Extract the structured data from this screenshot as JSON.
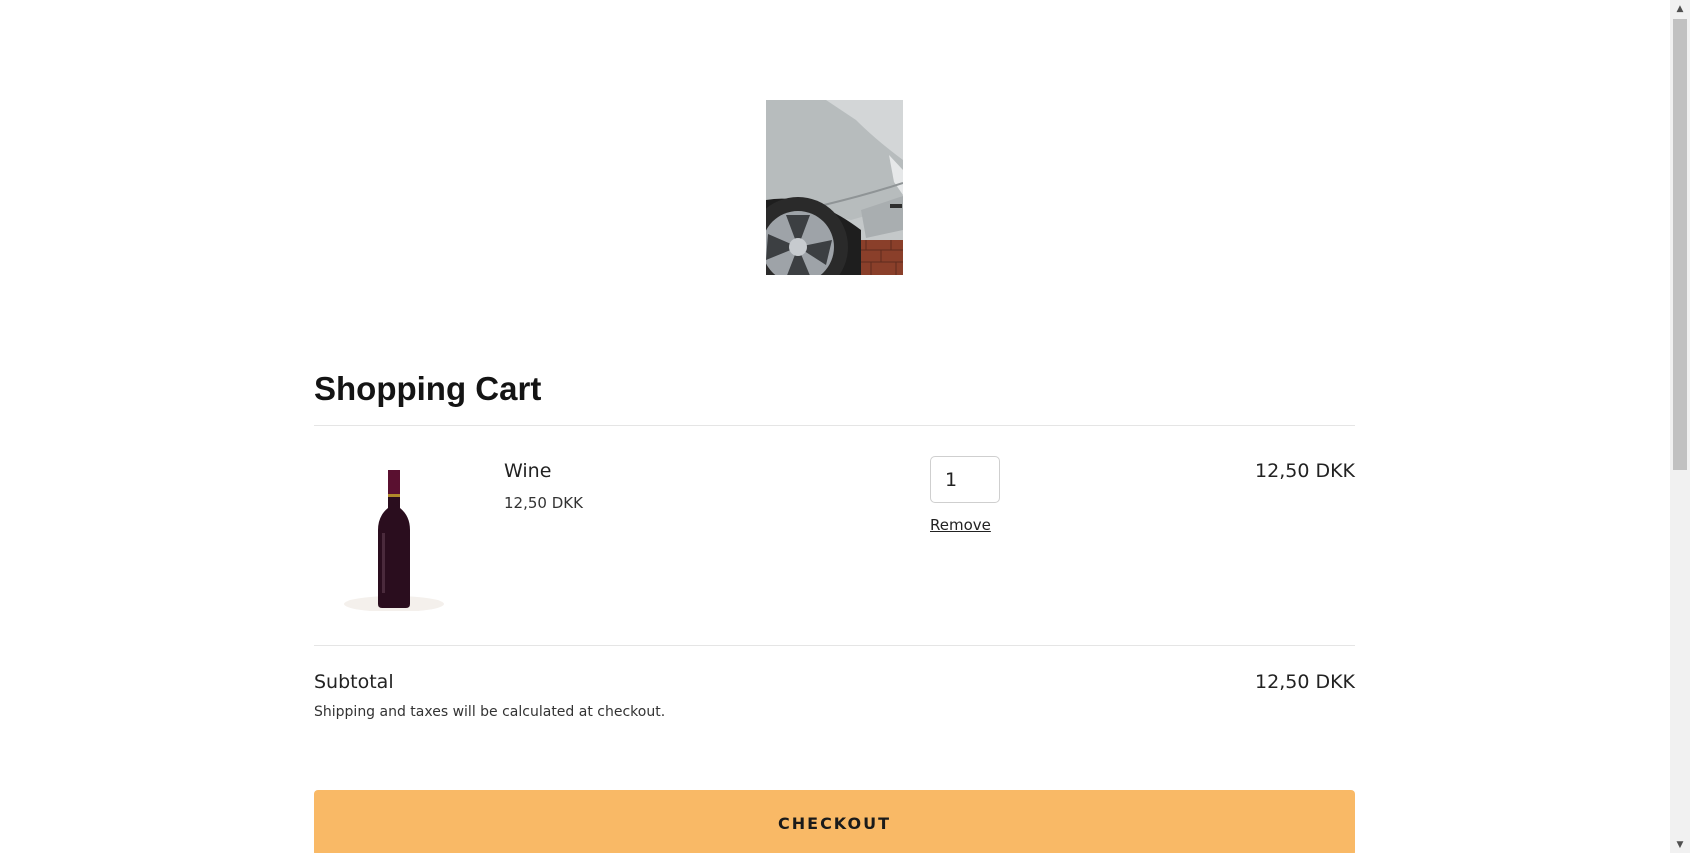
{
  "hero": {
    "image_name": "car-photo",
    "colors": {
      "body": "#b9bebf",
      "wheel": "#2a2a2a",
      "rim": "#9ea3a8",
      "floor": "#8a3f2a"
    }
  },
  "cart": {
    "title": "Shopping Cart",
    "items": [
      {
        "name": "Wine",
        "unit_price": "12,50 DKK",
        "quantity": "1",
        "remove_label": "Remove",
        "line_total": "12,50 DKK",
        "image_name": "wine-bottle-image"
      }
    ],
    "subtotal_label": "Subtotal",
    "subtotal_value": "12,50 DKK",
    "shipping_note": "Shipping and taxes will be calculated at checkout.",
    "checkout_label": "CHECKOUT"
  },
  "colors": {
    "accent": "#f9b966",
    "divider": "#e5e5e5",
    "text": "#222222"
  },
  "scrollbar": {
    "up_icon": "▲",
    "down_icon": "▼"
  }
}
